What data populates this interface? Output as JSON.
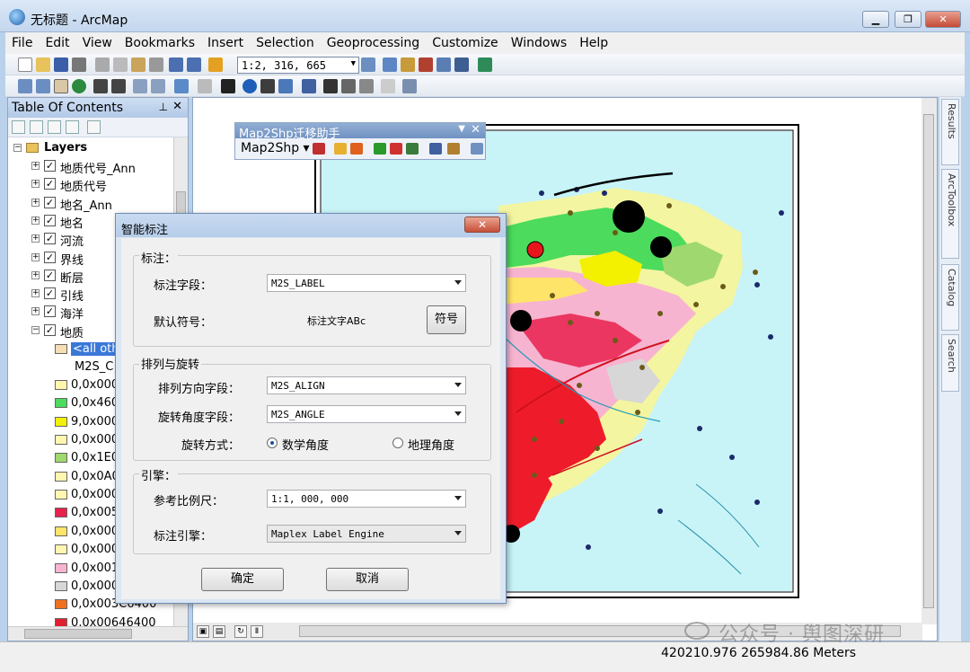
{
  "window": {
    "title": "无标题 - ArcMap"
  },
  "menu": [
    "File",
    "Edit",
    "View",
    "Bookmarks",
    "Insert",
    "Selection",
    "Geoprocessing",
    "Customize",
    "Windows",
    "Help"
  ],
  "scale": "1:2, 316, 665",
  "toc": {
    "title": "Table Of Contents",
    "root": "Layers",
    "layers": [
      "地质代号_Ann",
      "地质代号",
      "地名_Ann",
      "地名",
      "河流",
      "界线",
      "断层",
      "引线",
      "海洋",
      "地质"
    ],
    "sublabels": {
      "all_other": "<all oth",
      "field": "M2S_C"
    },
    "legend": [
      {
        "label": "0,0x000",
        "color": "#fff6b0"
      },
      {
        "label": "0,0x460",
        "color": "#4cdb5c"
      },
      {
        "label": "9,0x000",
        "color": "#f3f000"
      },
      {
        "label": "0,0x000",
        "color": "#fff6b0"
      },
      {
        "label": "0,0x1E0",
        "color": "#9fd86f"
      },
      {
        "label": "0,0x0A0",
        "color": "#fff6b0"
      },
      {
        "label": "0,0x000",
        "color": "#fff6b0"
      },
      {
        "label": "0,0x005",
        "color": "#e8204c"
      },
      {
        "label": "0,0x000",
        "color": "#ffe46a"
      },
      {
        "label": "0,0x000",
        "color": "#fff6b0"
      },
      {
        "label": "0,0x001",
        "color": "#f7b4d0"
      },
      {
        "label": "0,0x000",
        "color": "#d7d7d7"
      },
      {
        "label": "0,0x003C6400",
        "color": "#f07020"
      },
      {
        "label": "0,0x00646400",
        "color": "#e02030"
      }
    ]
  },
  "map2shp": {
    "title": "Map2Shp迁移助手",
    "menu_label": "Map2Shp"
  },
  "dialog": {
    "title": "智能标注",
    "close": "✕",
    "group_label": {
      "title": "标注：",
      "field_label": "标注字段：",
      "field_value": "M2S_LABEL",
      "symbol_label": "默认符号：",
      "symbol_preview": "标注文字ABc",
      "symbol_button": "符号"
    },
    "group_align": {
      "title": "排列与旋转",
      "align_label": "排列方向字段：",
      "align_value": "M2S_ALIGN",
      "angle_label": "旋转角度字段：",
      "angle_value": "M2S_ANGLE",
      "mode_label": "旋转方式：",
      "opt_math": "数学角度",
      "opt_geo": "地理角度"
    },
    "group_engine": {
      "title": "引擎：",
      "scale_label": "参考比例尺：",
      "scale_value": "1:1, 000, 000",
      "engine_label": "标注引擎：",
      "engine_value": "Maplex Label Engine"
    },
    "ok": "确定",
    "cancel": "取消"
  },
  "dock": [
    "Results",
    "ArcToolbox",
    "Catalog",
    "Search"
  ],
  "status": {
    "coords": "420210.976  265984.86 Meters"
  },
  "watermark": "公众号 · 舆图深研"
}
